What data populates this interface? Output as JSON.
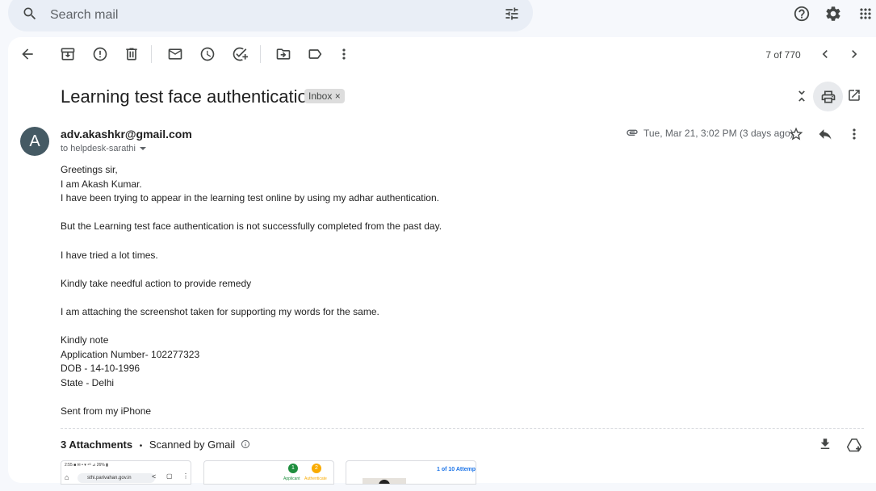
{
  "search": {
    "placeholder": "Search mail"
  },
  "toolbar": {
    "pager": "7 of 770"
  },
  "email": {
    "subject": "Learning test face authentication",
    "label": "Inbox",
    "label_close": "×",
    "sender": "adv.akashkr@gmail.com",
    "avatar_letter": "A",
    "avatar_color": "#455a64",
    "recipient": "to helpdesk-sarathi",
    "date": "Tue, Mar 21, 3:02 PM (3 days ago)",
    "body": [
      "Greetings sir,",
      "I am Akash Kumar.",
      "I have been trying to appear in the learning test online by using my adhar authentication.",
      "",
      "But the Learning test face authentication is not successfully completed from the past day.",
      "",
      "I have tried a lot times.",
      "",
      "Kindly take needful action to provide remedy",
      "",
      "I am attaching the screenshot taken for supporting my words for the same.",
      "",
      "Kindly note",
      "Application Number- 102277323",
      "DOB - 14-10-1996",
      "State - Delhi",
      "",
      "Sent from my iPhone"
    ]
  },
  "attachments": {
    "title": "3 Attachments",
    "separator": "•",
    "scan_note": "Scanned by Gmail",
    "thumbs": [
      {
        "status": "2:55 ■ ✉ •          ▾ ⁴ᴳ ⊿ 26% ▮",
        "url": "sthi.parivahan.gov.in"
      },
      {
        "step1": "1",
        "step2": "2",
        "label1": "Applicant",
        "label2": "Authenticate"
      },
      {
        "text": "1 of 10 Attemp"
      }
    ]
  },
  "icons": {
    "top": [
      "search-icon",
      "filter-icon",
      "help-icon",
      "gear-icon",
      "apps-icon"
    ],
    "toolbar": [
      "back-arrow-icon",
      "archive-icon",
      "report-spam-icon",
      "delete-icon",
      "mark-unread-icon",
      "snooze-icon",
      "add-task-icon",
      "move-to-icon",
      "label-icon",
      "more-vert-icon",
      "chevron-left-icon",
      "chevron-right-icon"
    ],
    "message": [
      "collapse-icon",
      "print-icon",
      "open-new-window-icon",
      "paperclip-icon",
      "star-icon",
      "reply-icon",
      "more-vert-icon",
      "download-icon",
      "add-to-drive-icon",
      "info-icon"
    ]
  },
  "colors": {
    "background": "#f6f8fc",
    "search_bg": "#e9eef6",
    "panel": "#ffffff",
    "icon": "#444746"
  }
}
